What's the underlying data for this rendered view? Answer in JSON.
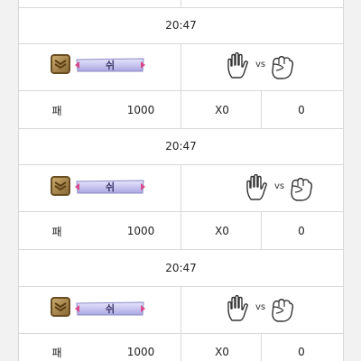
{
  "records": [
    {
      "time": "20:47",
      "banner_text": "쉬",
      "vs_label": "vs",
      "result": "패",
      "bet": "1000",
      "multiplier": "X0",
      "payout": "0"
    },
    {
      "time": "20:47",
      "banner_text": "쉬",
      "vs_label": "vs",
      "result": "패",
      "bet": "1000",
      "multiplier": "X0",
      "payout": "0"
    },
    {
      "time": "20:47",
      "banner_text": "쉬",
      "vs_label": "vs",
      "result": "패",
      "bet": "1000",
      "multiplier": "X0",
      "payout": "0"
    }
  ],
  "player_hand_icon": "open-hand-paper-icon",
  "opponent_hand_icon": "fist-rock-icon",
  "rank_badge_icon": "rank-chevron-badge-icon",
  "colors": {
    "border": "#d8d8d8",
    "badge_gold": "#b8965a",
    "banner_lavender": "#c9c7f0"
  }
}
